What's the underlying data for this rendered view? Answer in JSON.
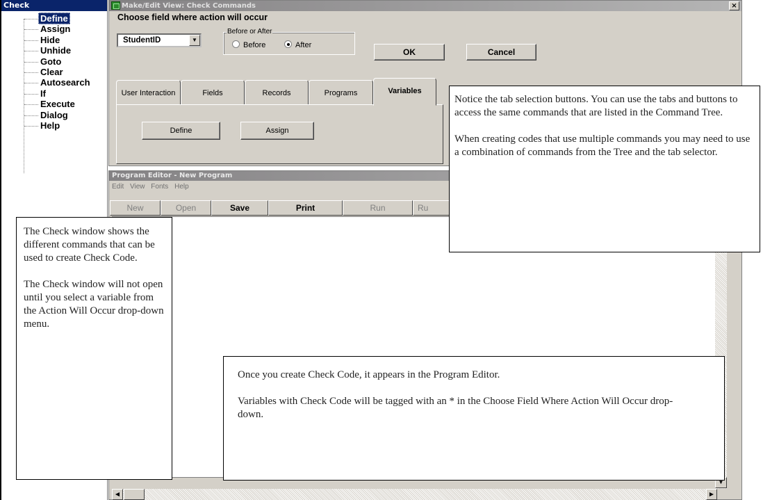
{
  "check_window": {
    "title": "Check",
    "items": [
      {
        "label": "Define",
        "selected": true
      },
      {
        "label": "Assign"
      },
      {
        "label": "Hide"
      },
      {
        "label": "Unhide"
      },
      {
        "label": "Goto"
      },
      {
        "label": "Clear"
      },
      {
        "label": "Autosearch"
      },
      {
        "label": "If"
      },
      {
        "label": "Execute"
      },
      {
        "label": "Dialog"
      },
      {
        "label": "Help"
      }
    ]
  },
  "dialog": {
    "title": "Make/Edit View: Check Commands",
    "close_glyph": "×",
    "choose_label": "Choose field where action will occur",
    "field_value": "StudentID",
    "before_after": {
      "legend": "Before or After",
      "before_label": "Before",
      "after_label": "After",
      "selected": "After"
    },
    "ok_label": "OK",
    "cancel_label": "Cancel",
    "tabs": [
      "User Interaction",
      "Fields",
      "Records",
      "Programs",
      "Variables"
    ],
    "active_tab": "Variables",
    "panel_buttons": [
      "Define",
      "Assign"
    ]
  },
  "editor": {
    "title": "Program Editor - New Program",
    "menu": [
      "Edit",
      "View",
      "Fonts",
      "Help"
    ],
    "toolbar": [
      {
        "label": "New",
        "enabled": false
      },
      {
        "label": "Open",
        "enabled": false
      },
      {
        "label": "Save",
        "enabled": true
      },
      {
        "label": "Print",
        "enabled": true
      },
      {
        "label": "Run",
        "enabled": false
      },
      {
        "label": "Ru",
        "enabled": false
      }
    ]
  },
  "callouts": {
    "tabs_note": {
      "p1": "Notice the tab selection buttons. You can use the tabs and buttons to access the same commands that are listed in the Command Tree.",
      "p2": "When creating codes that use multiple commands you may need to use a combination of commands from the Tree and the tab selector."
    },
    "check_note": {
      "p1": "The Check window shows the different commands that can be used to create Check Code.",
      "p2": "The Check window will not open until you select a variable from the Action Will Occur drop-down menu."
    },
    "editor_note": {
      "p1": "Once you create Check Code, it appears in the Program Editor.",
      "p2": "Variables with Check Code will be tagged with an * in the Choose Field Where Action Will Occur drop-down."
    }
  }
}
